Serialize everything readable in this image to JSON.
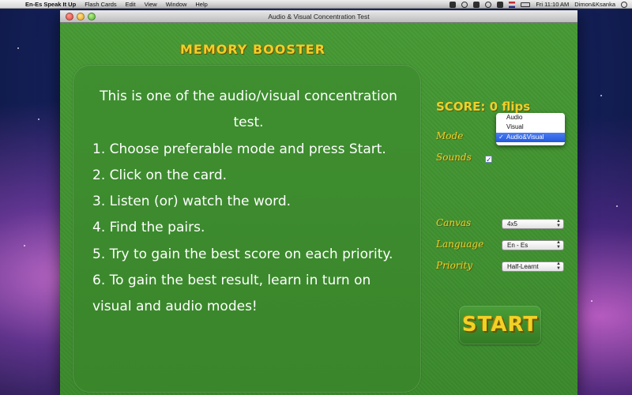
{
  "menubar": {
    "app_name": "En-Es Speak It Up",
    "items": [
      "Flash Cards",
      "Edit",
      "View",
      "Window",
      "Help"
    ],
    "clock": "Fri 11:10 AM",
    "user": "Dimon&Ksanka"
  },
  "window": {
    "title": "Audio & Visual Concentration Test"
  },
  "main": {
    "heading": "MEMORY BOOSTER",
    "instructions": [
      "This is one of the audio/visual concentration test.",
      "1. Choose preferable mode and press Start.",
      "2. Click on the card.",
      "3. Listen (or) watch the word.",
      "4. Find the pairs.",
      "5. Try to gain the best score on each priority.",
      "6. To gain the best result, learn in turn on visual and audio modes!"
    ]
  },
  "controls": {
    "score_label": "SCORE: 0 flips",
    "mode_label": "Mode",
    "mode_options": [
      "Audio",
      "Visual",
      "Audio&Visual"
    ],
    "mode_selected_index": 2,
    "sounds_label": "Sounds",
    "sounds_checked": true,
    "canvas_label": "Canvas",
    "canvas_value": "4x5",
    "language_label": "Language",
    "language_value": "En - Es",
    "priority_label": "Priority",
    "priority_value": "Half-Learnt",
    "start_label": "START"
  },
  "colors": {
    "felt_green": "#3f8f2f",
    "label_yellow": "#f0cf2a",
    "selection_blue": "#2358de"
  }
}
